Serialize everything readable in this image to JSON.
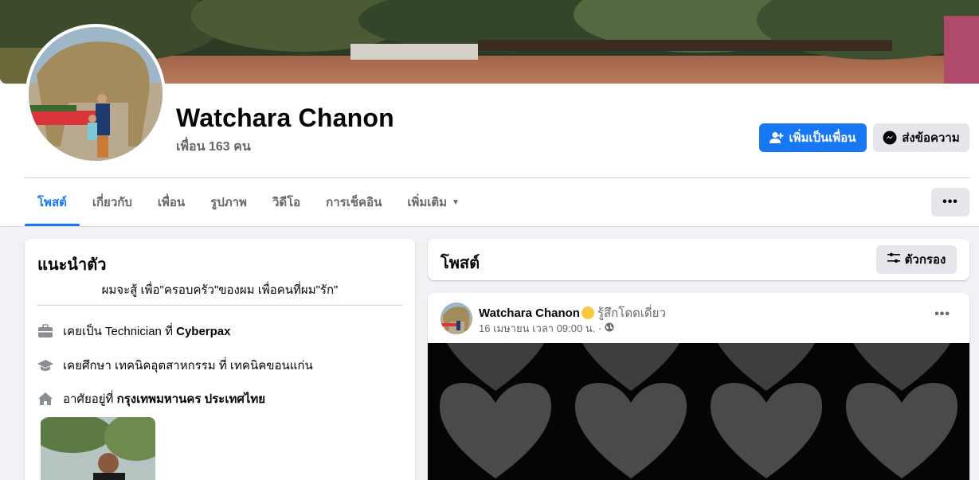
{
  "profile": {
    "name": "Watchara Chanon",
    "friends_label": "เพื่อน 163 คน"
  },
  "actions": {
    "add_friend": "เพิ่มเป็นเพื่อน",
    "message": "ส่งข้อความ"
  },
  "tabs": [
    {
      "label": "โพสต์",
      "active": true
    },
    {
      "label": "เกี่ยวกับ",
      "active": false
    },
    {
      "label": "เพื่อน",
      "active": false
    },
    {
      "label": "รูปภาพ",
      "active": false
    },
    {
      "label": "วิดีโอ",
      "active": false
    },
    {
      "label": "การเช็คอิน",
      "active": false
    },
    {
      "label": "เพิ่มเติม",
      "active": false
    }
  ],
  "intro": {
    "title": "แนะนำตัว",
    "bio": "ผมจะสู้ เพื่อ\"ครอบครัว\"ของผม เพื่อคนที่ผม\"รัก\"",
    "work_prefix": "เคยเป็น Technician ที่ ",
    "work_place": "Cyberpax",
    "education": "เคยศึกษา เทคนิคอุตสาหกรรม ที่ เทคนิคขอนแก่น",
    "home_prefix": "อาศัยอยู่ที่ ",
    "home_place": "กรุงเทพมหานคร ประเทศไทย"
  },
  "posts_header": {
    "title": "โพสต์",
    "filter_label": "ตัวกรอง"
  },
  "post": {
    "author": "Watchara Chanon",
    "feeling": "รู้สึกโดดเดี่ยว",
    "date": "16 เมษายน เวลา 09:00 น. ·"
  },
  "icons": {
    "add_friend": "add-person-icon",
    "message": "messenger-icon",
    "work": "briefcase-icon",
    "education": "graduation-cap-icon",
    "home": "home-icon",
    "filter": "filter-sliders-icon",
    "privacy": "globe-icon",
    "more": "more-dots-icon"
  },
  "colors": {
    "accent": "#1877f2",
    "secondary_button": "#e4e6eb",
    "background": "#f0f2f5",
    "muted_text": "#65676b"
  }
}
